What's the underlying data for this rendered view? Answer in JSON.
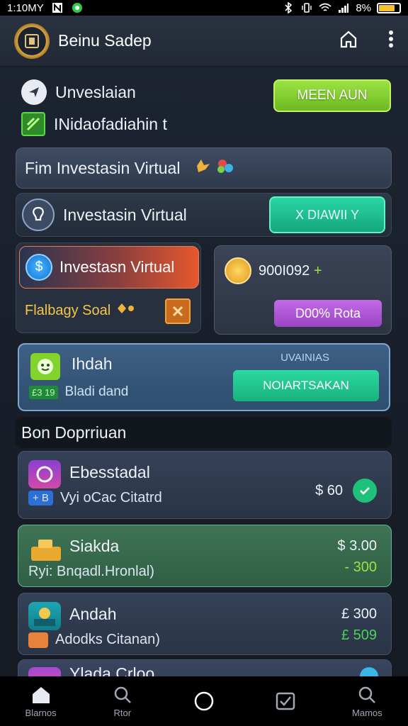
{
  "status_bar": {
    "time": "1:10MY",
    "battery": "8%",
    "battery_level": 0.8
  },
  "app_bar": {
    "title": "Beinu Sadep"
  },
  "top_row": {
    "line1": "Unveslaian",
    "line2": "INidaofadiahin t",
    "action_button": "MEEN AUN"
  },
  "cards": {
    "fim_title": "Fim Investasin Virtual",
    "virtual_title": "Investasin Virtual",
    "virtual_button": "X DIAWII Y",
    "red_title": "Investasn Virtual",
    "red_sub": "Flalbagy Soal",
    "coin_amount": "900I092",
    "coin_plus": "+",
    "purple_button": "D00% Rota",
    "indah_title": "Ihdah",
    "indah_badge": "£3 19",
    "indah_sub": "Bladi dand",
    "indah_label": "UVAINIAS",
    "indah_button": "NOIARTSAKAN"
  },
  "section": {
    "title": "Bon Doprriuan"
  },
  "transactions": [
    {
      "title": "Ebesstadal",
      "badge": "+ B",
      "sub": "Vyi oCac Citatrd",
      "right_top": "",
      "right_bottom": "$ 60"
    },
    {
      "title": "Siakda",
      "badge": "",
      "sub": "Ryi: Bnqadl.Hronlal)",
      "right_top": "$ 3.00",
      "right_bottom": "- 300"
    },
    {
      "title": "Andah",
      "badge": "",
      "sub": "Adodks Citanan)",
      "right_top": "£ 300",
      "right_bottom": "£ 509"
    },
    {
      "title": "Ylada Crloo",
      "badge": "",
      "sub": "",
      "right_top": "",
      "right_bottom": ""
    }
  ],
  "nav": {
    "items": [
      "Blarnos",
      "Rtor",
      "",
      "",
      "Mamos"
    ]
  },
  "colors": {
    "accent_lime": "#9be343",
    "accent_teal": "#2ad7a3",
    "accent_purple": "#c36ae4",
    "positive_green": "#4bd35a"
  }
}
